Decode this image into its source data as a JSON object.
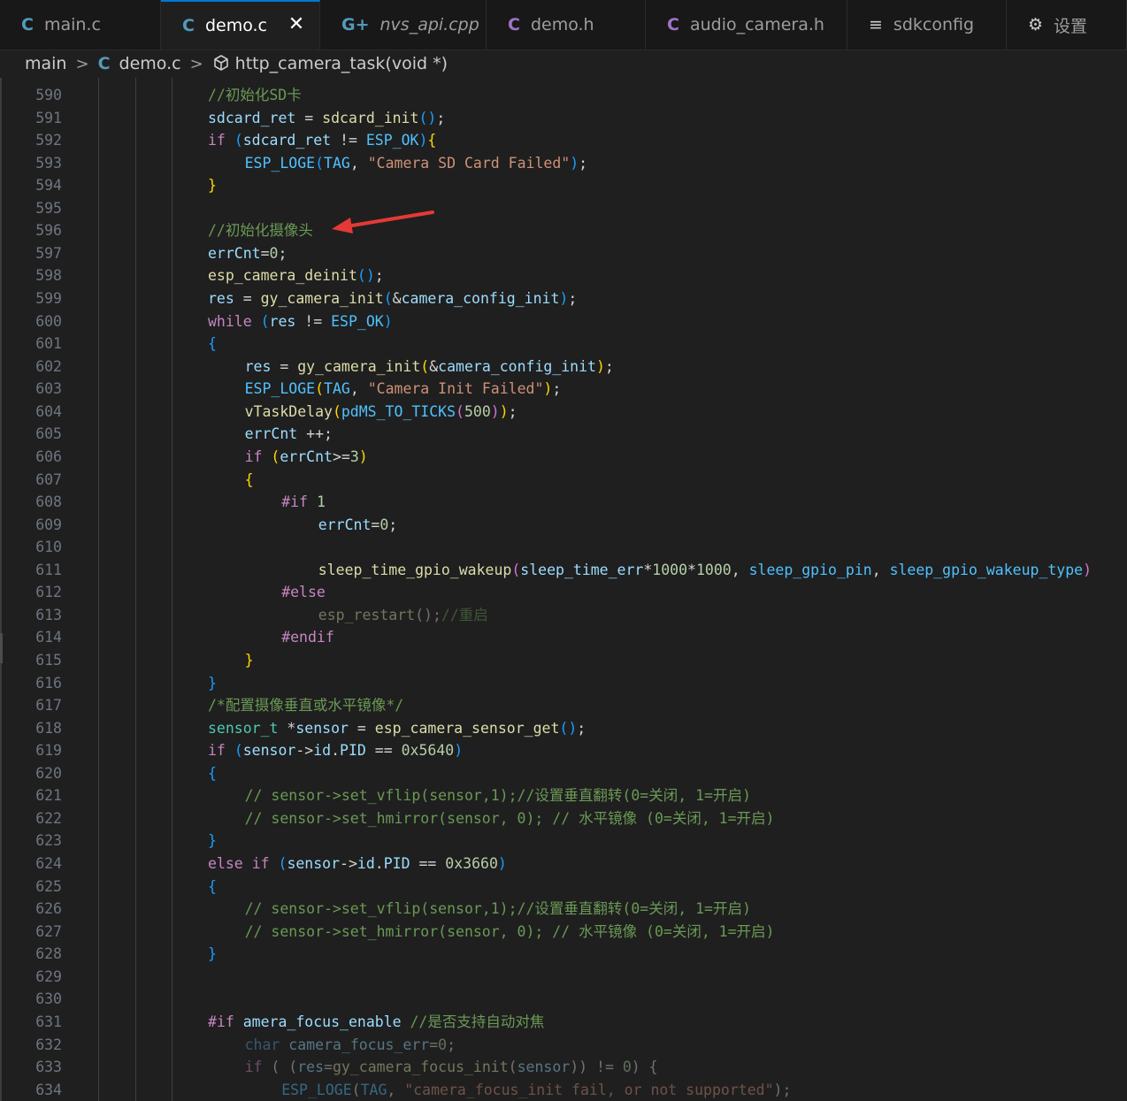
{
  "tabs": [
    {
      "label": "main.c",
      "icon": "C",
      "kind": "c",
      "active": false,
      "italic": false,
      "width": 182
    },
    {
      "label": "demo.c",
      "icon": "C",
      "kind": "c",
      "active": true,
      "italic": false,
      "width": 180
    },
    {
      "label": "nvs_api.cpp",
      "icon": "G+",
      "kind": "cpp",
      "active": false,
      "italic": true,
      "width": 188
    },
    {
      "label": "demo.h",
      "icon": "C",
      "kind": "h",
      "active": false,
      "italic": false,
      "width": 180
    },
    {
      "label": "audio_camera.h",
      "icon": "C",
      "kind": "h",
      "active": false,
      "italic": false,
      "width": 228
    },
    {
      "label": "sdkconfig",
      "icon": "≡",
      "kind": "cfg",
      "active": false,
      "italic": false,
      "width": 180
    },
    {
      "label": "设置",
      "icon": "⚙",
      "kind": "cfg",
      "active": false,
      "italic": false,
      "width": 136
    }
  ],
  "breadcrumb": {
    "folder": "main",
    "file_icon": "C",
    "file": "demo.c",
    "symbol": "http_camera_task(void *)"
  },
  "editor": {
    "first_line": 590,
    "lines": [
      {
        "n": "590",
        "indent": 0,
        "tokens": [
          [
            "cm",
            "//初始化SD卡"
          ]
        ]
      },
      {
        "n": "591",
        "indent": 0,
        "tokens": [
          [
            "var",
            "sdcard_ret"
          ],
          [
            "txt",
            " = "
          ],
          [
            "fn",
            "sdcard_init"
          ],
          [
            "p3",
            "()"
          ],
          [
            "txt",
            ";"
          ]
        ]
      },
      {
        "n": "592",
        "indent": 0,
        "tokens": [
          [
            "kc",
            "if"
          ],
          [
            "txt",
            " "
          ],
          [
            "p3",
            "("
          ],
          [
            "var",
            "sdcard_ret"
          ],
          [
            "txt",
            " != "
          ],
          [
            "const",
            "ESP_OK"
          ],
          [
            "p3",
            ")"
          ],
          [
            "p1",
            "{"
          ]
        ]
      },
      {
        "n": "593",
        "indent": 1,
        "tokens": [
          [
            "const",
            "ESP_LOGE"
          ],
          [
            "p3",
            "("
          ],
          [
            "const",
            "TAG"
          ],
          [
            "txt",
            ", "
          ],
          [
            "str",
            "\"Camera SD Card Failed\""
          ],
          [
            "p3",
            ")"
          ],
          [
            "txt",
            ";"
          ]
        ]
      },
      {
        "n": "594",
        "indent": 0,
        "tokens": [
          [
            "p1",
            "}"
          ]
        ]
      },
      {
        "n": "595",
        "indent": 0,
        "tokens": []
      },
      {
        "n": "596",
        "indent": 0,
        "tokens": [
          [
            "cm",
            "//初始化摄像头"
          ]
        ]
      },
      {
        "n": "597",
        "indent": 0,
        "tokens": [
          [
            "var",
            "errCnt"
          ],
          [
            "txt",
            "="
          ],
          [
            "num",
            "0"
          ],
          [
            "txt",
            ";"
          ]
        ]
      },
      {
        "n": "598",
        "indent": 0,
        "tokens": [
          [
            "fn",
            "esp_camera_deinit"
          ],
          [
            "p3",
            "()"
          ],
          [
            "txt",
            ";"
          ]
        ]
      },
      {
        "n": "599",
        "indent": 0,
        "tokens": [
          [
            "var",
            "res"
          ],
          [
            "txt",
            " = "
          ],
          [
            "fn",
            "gy_camera_init"
          ],
          [
            "p3",
            "("
          ],
          [
            "txt",
            "&"
          ],
          [
            "var",
            "camera_config_init"
          ],
          [
            "p3",
            ")"
          ],
          [
            "txt",
            ";"
          ]
        ]
      },
      {
        "n": "600",
        "indent": 0,
        "tokens": [
          [
            "kc",
            "while"
          ],
          [
            "txt",
            " "
          ],
          [
            "p3",
            "("
          ],
          [
            "var",
            "res"
          ],
          [
            "txt",
            " != "
          ],
          [
            "const",
            "ESP_OK"
          ],
          [
            "p3",
            ")"
          ]
        ]
      },
      {
        "n": "601",
        "indent": 0,
        "tokens": [
          [
            "p3",
            "{"
          ]
        ]
      },
      {
        "n": "602",
        "indent": 1,
        "tokens": [
          [
            "var",
            "res"
          ],
          [
            "txt",
            " = "
          ],
          [
            "fn",
            "gy_camera_init"
          ],
          [
            "p1",
            "("
          ],
          [
            "txt",
            "&"
          ],
          [
            "var",
            "camera_config_init"
          ],
          [
            "p1",
            ")"
          ],
          [
            "txt",
            ";"
          ]
        ]
      },
      {
        "n": "603",
        "indent": 1,
        "tokens": [
          [
            "const",
            "ESP_LOGE"
          ],
          [
            "p1",
            "("
          ],
          [
            "const",
            "TAG"
          ],
          [
            "txt",
            ", "
          ],
          [
            "str",
            "\"Camera Init Failed\""
          ],
          [
            "p1",
            ")"
          ],
          [
            "txt",
            ";"
          ]
        ]
      },
      {
        "n": "604",
        "indent": 1,
        "tokens": [
          [
            "fn",
            "vTaskDelay"
          ],
          [
            "p1",
            "("
          ],
          [
            "const",
            "pdMS_TO_TICKS"
          ],
          [
            "p2",
            "("
          ],
          [
            "num",
            "500"
          ],
          [
            "p2",
            ")"
          ],
          [
            "p1",
            ")"
          ],
          [
            "txt",
            ";"
          ]
        ]
      },
      {
        "n": "605",
        "indent": 1,
        "tokens": [
          [
            "var",
            "errCnt"
          ],
          [
            "txt",
            " ++;"
          ]
        ]
      },
      {
        "n": "606",
        "indent": 1,
        "tokens": [
          [
            "kc",
            "if"
          ],
          [
            "txt",
            " "
          ],
          [
            "p1",
            "("
          ],
          [
            "var",
            "errCnt"
          ],
          [
            "txt",
            ">="
          ],
          [
            "num",
            "3"
          ],
          [
            "p1",
            ")"
          ]
        ]
      },
      {
        "n": "607",
        "indent": 1,
        "tokens": [
          [
            "p1",
            "{"
          ]
        ]
      },
      {
        "n": "608",
        "indent": 2,
        "tokens": [
          [
            "kc",
            "#if"
          ],
          [
            "txt",
            " "
          ],
          [
            "num",
            "1"
          ]
        ]
      },
      {
        "n": "609",
        "indent": 3,
        "tokens": [
          [
            "var",
            "errCnt"
          ],
          [
            "txt",
            "="
          ],
          [
            "num",
            "0"
          ],
          [
            "txt",
            ";"
          ]
        ]
      },
      {
        "n": "610",
        "indent": 0,
        "tokens": []
      },
      {
        "n": "611",
        "indent": 3,
        "tokens": [
          [
            "fn",
            "sleep_time_gpio_wakeup"
          ],
          [
            "p2",
            "("
          ],
          [
            "var",
            "sleep_time_err"
          ],
          [
            "txt",
            "*"
          ],
          [
            "num",
            "1000"
          ],
          [
            "txt",
            "*"
          ],
          [
            "num",
            "1000"
          ],
          [
            "txt",
            ", "
          ],
          [
            "const",
            "sleep_gpio_pin"
          ],
          [
            "txt",
            ", "
          ],
          [
            "const",
            "sleep_gpio_wakeup_type"
          ],
          [
            "p2",
            ")"
          ]
        ]
      },
      {
        "n": "612",
        "indent": 2,
        "tokens": [
          [
            "kc",
            "#else"
          ]
        ]
      },
      {
        "n": "613",
        "indent": 3,
        "dim": true,
        "tokens": [
          [
            "fn",
            "esp_restart"
          ],
          [
            "txt",
            "();"
          ],
          [
            "cm",
            "//重启"
          ]
        ]
      },
      {
        "n": "614",
        "indent": 2,
        "tokens": [
          [
            "kc",
            "#endif"
          ]
        ]
      },
      {
        "n": "615",
        "indent": 1,
        "tokens": [
          [
            "p1",
            "}"
          ]
        ]
      },
      {
        "n": "616",
        "indent": 0,
        "tokens": [
          [
            "p3",
            "}"
          ]
        ]
      },
      {
        "n": "617",
        "indent": 0,
        "tokens": [
          [
            "cm",
            "/*配置摄像垂直或水平镜像*/"
          ]
        ]
      },
      {
        "n": "618",
        "indent": 0,
        "tokens": [
          [
            "type",
            "sensor_t"
          ],
          [
            "txt",
            " *"
          ],
          [
            "var",
            "sensor"
          ],
          [
            "txt",
            " = "
          ],
          [
            "fn",
            "esp_camera_sensor_get"
          ],
          [
            "p3",
            "()"
          ],
          [
            "txt",
            ";"
          ]
        ]
      },
      {
        "n": "619",
        "indent": 0,
        "tokens": [
          [
            "kc",
            "if"
          ],
          [
            "txt",
            " "
          ],
          [
            "p3",
            "("
          ],
          [
            "var",
            "sensor"
          ],
          [
            "txt",
            "->"
          ],
          [
            "var",
            "id"
          ],
          [
            "txt",
            "."
          ],
          [
            "var",
            "PID"
          ],
          [
            "txt",
            " == "
          ],
          [
            "num",
            "0x5640"
          ],
          [
            "p3",
            ")"
          ]
        ]
      },
      {
        "n": "620",
        "indent": 0,
        "tokens": [
          [
            "p3",
            "{"
          ]
        ]
      },
      {
        "n": "621",
        "indent": 1,
        "tokens": [
          [
            "cm",
            "// sensor->set_vflip(sensor,1);//设置垂直翻转(0=关闭, 1=开启)"
          ]
        ]
      },
      {
        "n": "622",
        "indent": 1,
        "tokens": [
          [
            "cm",
            "// sensor->set_hmirror(sensor, 0); // 水平镜像 (0=关闭, 1=开启)"
          ]
        ]
      },
      {
        "n": "623",
        "indent": 0,
        "tokens": [
          [
            "p3",
            "}"
          ]
        ]
      },
      {
        "n": "624",
        "indent": 0,
        "tokens": [
          [
            "kc",
            "else"
          ],
          [
            "txt",
            " "
          ],
          [
            "kc",
            "if"
          ],
          [
            "txt",
            " "
          ],
          [
            "p3",
            "("
          ],
          [
            "var",
            "sensor"
          ],
          [
            "txt",
            "->"
          ],
          [
            "var",
            "id"
          ],
          [
            "txt",
            "."
          ],
          [
            "var",
            "PID"
          ],
          [
            "txt",
            " == "
          ],
          [
            "num",
            "0x3660"
          ],
          [
            "p3",
            ")"
          ]
        ]
      },
      {
        "n": "625",
        "indent": 0,
        "tokens": [
          [
            "p3",
            "{"
          ]
        ]
      },
      {
        "n": "626",
        "indent": 1,
        "tokens": [
          [
            "cm",
            "// sensor->set_vflip(sensor,1);//设置垂直翻转(0=关闭, 1=开启)"
          ]
        ]
      },
      {
        "n": "627",
        "indent": 1,
        "tokens": [
          [
            "cm",
            "// sensor->set_hmirror(sensor, 0); // 水平镜像 (0=关闭, 1=开启)"
          ]
        ]
      },
      {
        "n": "628",
        "indent": 0,
        "tokens": [
          [
            "p3",
            "}"
          ]
        ]
      },
      {
        "n": "629",
        "indent": 0,
        "tokens": []
      },
      {
        "n": "630",
        "indent": 0,
        "tokens": []
      },
      {
        "n": "631",
        "indent": 0,
        "tokens": [
          [
            "kc",
            "#if"
          ],
          [
            "txt",
            " "
          ],
          [
            "var",
            "amera_focus_enable"
          ],
          [
            "txt",
            " "
          ],
          [
            "cm",
            "//是否支持自动对焦"
          ]
        ]
      },
      {
        "n": "632",
        "indent": 1,
        "dim": true,
        "tokens": [
          [
            "kw",
            "char"
          ],
          [
            "txt",
            " "
          ],
          [
            "var",
            "camera_focus_err"
          ],
          [
            "txt",
            "="
          ],
          [
            "num",
            "0"
          ],
          [
            "txt",
            ";"
          ]
        ]
      },
      {
        "n": "633",
        "indent": 1,
        "dim": true,
        "tokens": [
          [
            "kc",
            "if"
          ],
          [
            "txt",
            " ( ("
          ],
          [
            "var",
            "res"
          ],
          [
            "txt",
            "="
          ],
          [
            "fn",
            "gy_camera_focus_init"
          ],
          [
            "txt",
            "("
          ],
          [
            "var",
            "sensor"
          ],
          [
            "txt",
            ")) != "
          ],
          [
            "num",
            "0"
          ],
          [
            "txt",
            ") {"
          ]
        ]
      },
      {
        "n": "634",
        "indent": 2,
        "dim": true,
        "tokens": [
          [
            "const",
            "ESP_LOGE"
          ],
          [
            "txt",
            "("
          ],
          [
            "const",
            "TAG"
          ],
          [
            "txt",
            ", "
          ],
          [
            "str",
            "\"camera_focus_init fail, or not supported\""
          ],
          [
            "txt",
            ");"
          ]
        ]
      }
    ]
  },
  "colors": {
    "background": "#1f1f1f",
    "accent": "#0078d4",
    "arrow": "#e53935"
  }
}
